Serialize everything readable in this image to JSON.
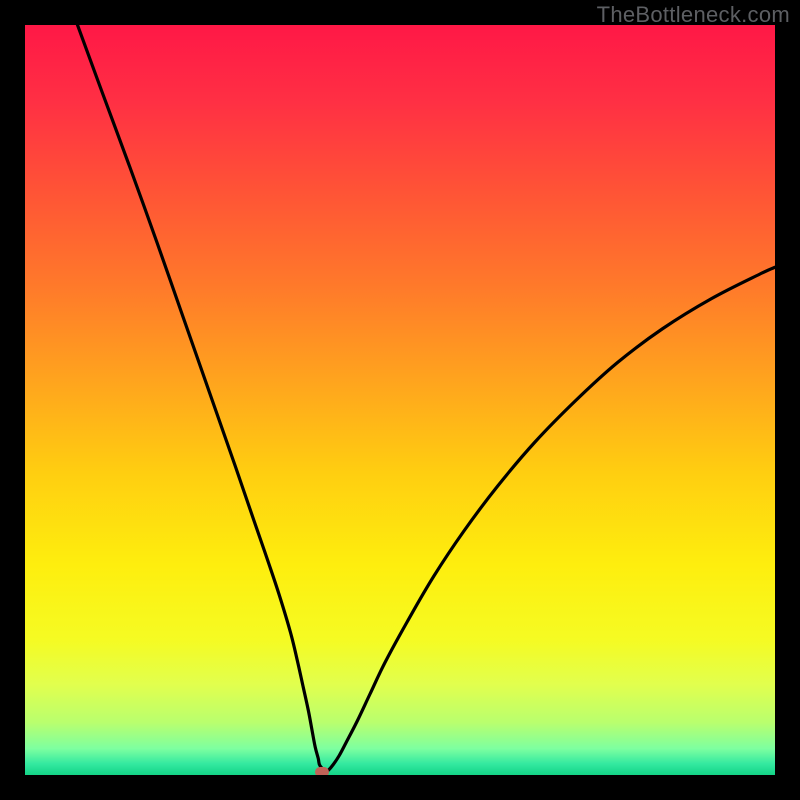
{
  "watermark": "TheBottleneck.com",
  "colors": {
    "frame_bg": "#000000",
    "curve_stroke": "#000000",
    "marker_fill": "#c06258"
  },
  "gradient_stops": [
    {
      "offset": 0.0,
      "color": "#ff1846"
    },
    {
      "offset": 0.1,
      "color": "#ff2f44"
    },
    {
      "offset": 0.22,
      "color": "#ff5336"
    },
    {
      "offset": 0.35,
      "color": "#ff7a2a"
    },
    {
      "offset": 0.48,
      "color": "#ffa61d"
    },
    {
      "offset": 0.6,
      "color": "#ffcf10"
    },
    {
      "offset": 0.72,
      "color": "#feee0e"
    },
    {
      "offset": 0.82,
      "color": "#f5fb23"
    },
    {
      "offset": 0.88,
      "color": "#e1ff4e"
    },
    {
      "offset": 0.93,
      "color": "#b9ff6e"
    },
    {
      "offset": 0.965,
      "color": "#7dffa0"
    },
    {
      "offset": 0.985,
      "color": "#34e9a0"
    },
    {
      "offset": 1.0,
      "color": "#13d487"
    }
  ],
  "chart_data": {
    "type": "line",
    "title": "",
    "xlabel": "",
    "ylabel": "",
    "xlim": [
      0,
      100
    ],
    "ylim": [
      0,
      100
    ],
    "series": [
      {
        "name": "bottleneck-curve",
        "x": [
          7.0,
          10.3,
          14.0,
          17.6,
          21.1,
          24.6,
          28.1,
          30.5,
          32.4,
          33.9,
          35.4,
          36.3,
          37.1,
          37.8,
          38.3,
          38.7,
          39.1,
          39.3,
          40.0,
          40.4,
          41.1,
          41.9,
          42.8,
          44.3,
          46.0,
          48.0,
          51.0,
          54.5,
          58.5,
          63.0,
          68.0,
          73.5,
          79.0,
          85.0,
          91.5,
          98.0,
          100.0
        ],
        "y": [
          100.0,
          91.0,
          81.0,
          71.0,
          61.0,
          51.0,
          41.0,
          34.0,
          28.5,
          24.0,
          19.0,
          15.3,
          11.7,
          8.5,
          5.8,
          3.7,
          2.2,
          1.3,
          0.6,
          0.6,
          1.4,
          2.6,
          4.3,
          7.2,
          10.8,
          15.0,
          20.5,
          26.5,
          32.5,
          38.5,
          44.4,
          50.0,
          55.0,
          59.5,
          63.5,
          66.8,
          67.7
        ]
      }
    ],
    "marker": {
      "x": 39.6,
      "y": 0.4
    }
  }
}
